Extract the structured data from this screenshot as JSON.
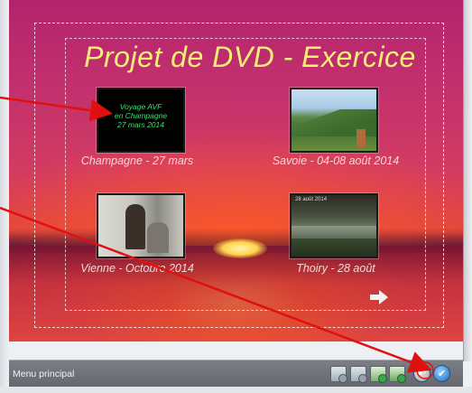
{
  "menu": {
    "title": "Projet de DVD - Exercice",
    "items": [
      {
        "label": "Champagne -  27 mars",
        "thumb_lines": [
          "Voyage AVF",
          "en Champagne",
          "27 mars 2014"
        ]
      },
      {
        "label": "Savoie - 04-08 août 2014"
      },
      {
        "label": "Vienne - Octobre 2014"
      },
      {
        "label": "Thoiry - 28 août",
        "thumb_caption": "28 août 2014"
      }
    ],
    "next_arrow_icon": "right-arrow-icon"
  },
  "status_bar": {
    "label": "Menu principal",
    "tools": [
      {
        "icon": "menu-layout-icon-1"
      },
      {
        "icon": "menu-layout-icon-2"
      },
      {
        "icon": "add-menu-icon"
      },
      {
        "icon": "add-submenu-icon"
      },
      {
        "icon": "undo-icon"
      },
      {
        "icon": "confirm-icon"
      }
    ]
  },
  "colors": {
    "title": "#f2ef73",
    "label": "#f4d9d9",
    "annotation_arrow": "#e01010",
    "thumb_text": "#3ce06a"
  }
}
